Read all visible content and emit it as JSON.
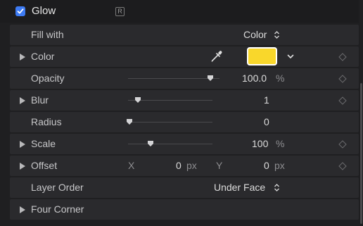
{
  "header": {
    "title": "Glow",
    "badge": "R",
    "checked": true
  },
  "rows": {
    "fill_with": {
      "label": "Fill with",
      "value": "Color"
    },
    "color": {
      "label": "Color",
      "swatch_color": "#f9d72b"
    },
    "opacity": {
      "label": "Opacity",
      "value": "100.0",
      "unit": "%",
      "slider": 1.0
    },
    "blur": {
      "label": "Blur",
      "value": "1",
      "slider": 0.05
    },
    "radius": {
      "label": "Radius",
      "value": "0",
      "slider": 0.0
    },
    "scale": {
      "label": "Scale",
      "value": "100",
      "unit": "%",
      "slider": 0.25
    },
    "offset": {
      "label": "Offset",
      "x_label": "X",
      "x_value": "0",
      "x_unit": "px",
      "y_label": "Y",
      "y_value": "0",
      "y_unit": "px"
    },
    "layer_order": {
      "label": "Layer Order",
      "value": "Under Face"
    },
    "four_corner": {
      "label": "Four Corner"
    }
  },
  "colors": {
    "accent": "#3d7bf4",
    "swatch": "#f9d72b"
  }
}
